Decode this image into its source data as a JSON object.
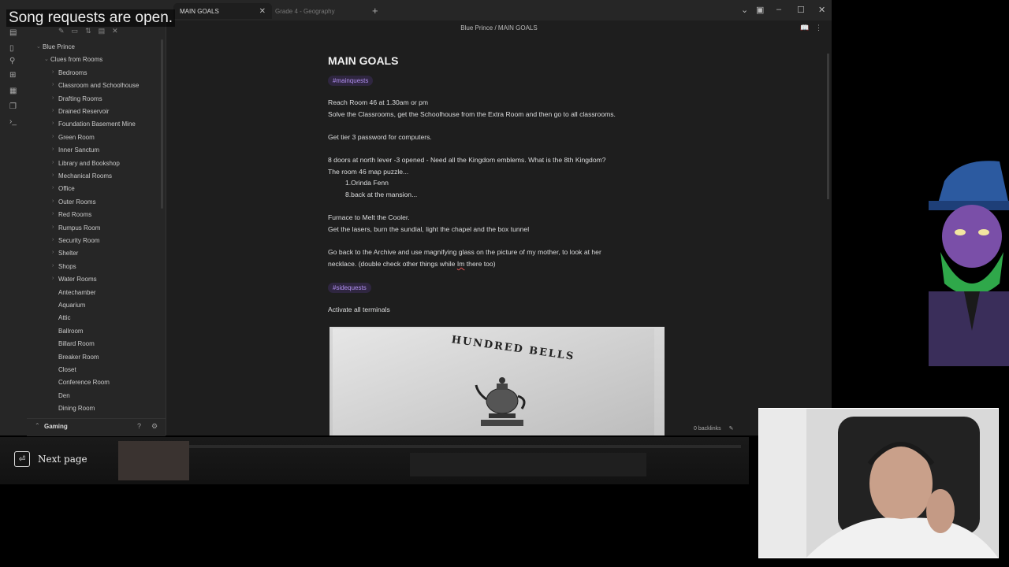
{
  "overlay": {
    "song_requests": "Song requests are open."
  },
  "tabs": [
    {
      "label": "MAIN GOALS",
      "active": true
    },
    {
      "label": "Grade 4 - Geography",
      "active": false
    }
  ],
  "breadcrumb": {
    "vault": "Blue Prince",
    "separator": "/",
    "note": "MAIN GOALS"
  },
  "sidebar": {
    "root": "Blue Prince",
    "folder": "Clues from Rooms",
    "subfolders": [
      "Bedrooms",
      "Classroom and Schoolhouse",
      "Drafting Rooms",
      "Drained Reservoir",
      "Foundation Basement Mine",
      "Green Room",
      "Inner Sanctum",
      "Library and Bookshop",
      "Mechanical Rooms",
      "Office",
      "Outer Rooms",
      "Red Rooms",
      "Rumpus Room",
      "Security Room",
      "Shelter",
      "Shops",
      "Water Rooms"
    ],
    "notes": [
      "Antechamber",
      "Aquarium",
      "Attic",
      "Ballroom",
      "Billard Room",
      "Breaker Room",
      "Closet",
      "Conference Room",
      "Den",
      "Dining Room"
    ],
    "vault_name": "Gaming"
  },
  "note": {
    "title": "MAIN GOALS",
    "tag_main": "#mainquests",
    "lines": [
      "Reach Room 46 at 1.30am or pm",
      "Solve the Classrooms, get the Schoolhouse from the Extra Room and then go to all classrooms.",
      "Get tier 3 password for computers.",
      "8 doors at north lever -3 opened - Need all the Kingdom emblems. What is the 8th Kingdom?",
      "The room 46 map puzzle...",
      "1.Orinda Fenn",
      "8.back at the mansion...",
      "Furnace to Melt the Cooler.",
      "Get the lasers, burn the sundial, light the chapel and the box tunnel",
      "Go back to the Archive and use magnifying glass on the picture of my mother, to look at her",
      "necklace. (double check other things while ",
      "Im",
      " there too)"
    ],
    "tag_side": "#sidequests",
    "side_line": "Activate all terminals",
    "image_caption": "HUNDRED BELLS"
  },
  "status": {
    "backlinks": "0 backlinks"
  },
  "game": {
    "next_page": "Next page"
  },
  "colors": {
    "accent": "#b18ff0",
    "bg": "#1e1e1e",
    "sidebar": "#262626"
  }
}
